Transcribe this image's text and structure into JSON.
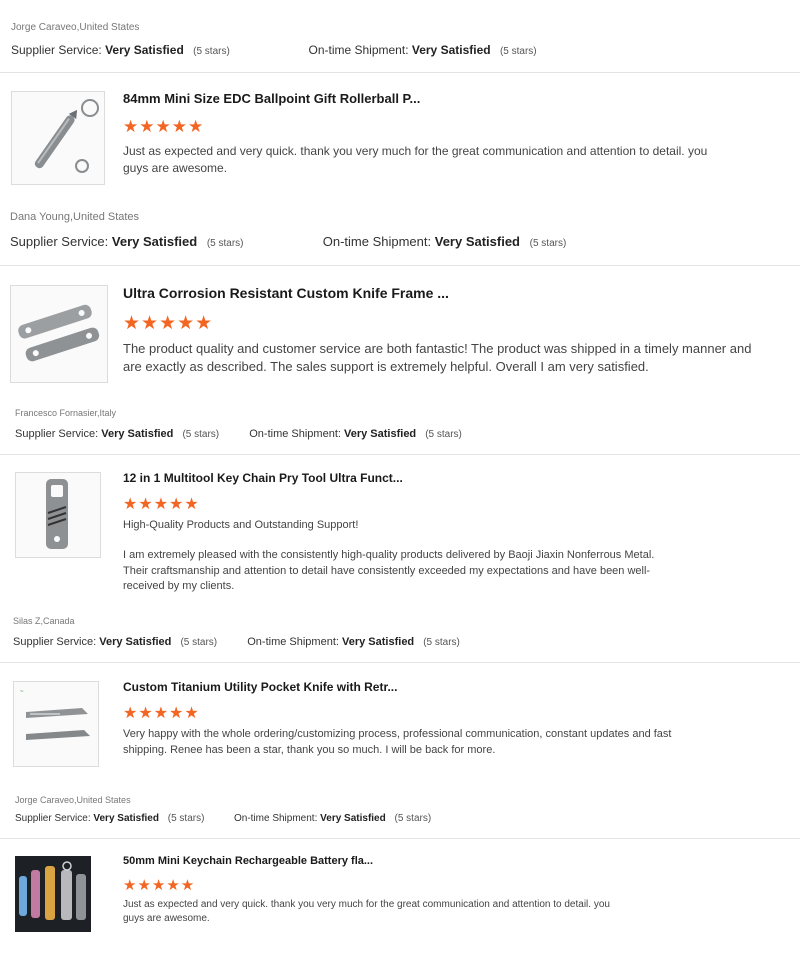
{
  "reviews": [
    {
      "reviewer": "Jorge Caraveo,United States",
      "supplier_label": "Supplier Service:",
      "supplier_value": "Very Satisfied",
      "supplier_stars": "(5 stars)",
      "shipment_label": "On-time Shipment:",
      "shipment_value": "Very Satisfied",
      "shipment_stars": "(5 stars)",
      "product_title": "84mm Mini Size EDC Ballpoint Gift Rollerball P...",
      "rating": 5,
      "stars_text": "★★★★★",
      "text": "Just as expected and very quick. thank you very much for the great communication and attention to detail. you guys are awesome.",
      "thumb_icon": "pen-product-icon"
    },
    {
      "reviewer": "Dana Young,United States",
      "supplier_label": "Supplier Service:",
      "supplier_value": "Very Satisfied",
      "supplier_stars": "(5 stars)",
      "shipment_label": "On-time Shipment:",
      "shipment_value": "Very Satisfied",
      "shipment_stars": "(5 stars)",
      "product_title": "Ultra Corrosion Resistant Custom Knife Frame ...",
      "rating": 5,
      "stars_text": "★★★★★",
      "text": "The product quality and customer service are both fantastic!  The product was shipped in a timely manner and are exactly as described.  The sales support is extremely helpful.  Overall I am very satisfied.",
      "thumb_icon": "knife-frame-product-icon"
    },
    {
      "reviewer": "Francesco Fornasier,Italy",
      "supplier_label": "Supplier Service:",
      "supplier_value": "Very Satisfied",
      "supplier_stars": "(5 stars)",
      "shipment_label": "On-time Shipment:",
      "shipment_value": "Very Satisfied",
      "shipment_stars": "(5 stars)",
      "product_title": "12 in 1 Multitool Key Chain Pry Tool Ultra Funct...",
      "rating": 5,
      "stars_text": "★★★★★",
      "text_heading": "High-Quality Products and Outstanding Support!",
      "text": "I am extremely pleased with the consistently high-quality products delivered by Baoji Jiaxin Nonferrous Metal. Their craftsmanship and attention to detail have consistently exceeded my expectations and have been well-received by my clients.",
      "thumb_icon": "multitool-product-icon"
    },
    {
      "reviewer": "Silas Z,Canada",
      "supplier_label": "Supplier Service:",
      "supplier_value": "Very Satisfied",
      "supplier_stars": "(5 stars)",
      "shipment_label": "On-time Shipment:",
      "shipment_value": "Very Satisfied",
      "shipment_stars": "(5 stars)",
      "product_title": "Custom Titanium Utility Pocket Knife with Retr...",
      "rating": 5,
      "stars_text": "★★★★★",
      "text": "Very happy with the whole ordering/customizing process, professional communication, constant updates and fast shipping. Renee has been a star, thank you so much. I will be back for more.",
      "thumb_icon": "utility-knife-product-icon"
    },
    {
      "reviewer": "Jorge Caraveo,United States",
      "supplier_label": "Supplier Service:",
      "supplier_value": "Very Satisfied",
      "supplier_stars": "(5 stars)",
      "shipment_label": "On-time Shipment:",
      "shipment_value": "Very Satisfied",
      "shipment_stars": "(5 stars)",
      "product_title": "50mm Mini Keychain Rechargeable Battery fla...",
      "rating": 5,
      "stars_text": "★★★★★",
      "text": "Just as expected and very quick. thank you very much for the great communication and attention to detail. you guys are awesome.",
      "thumb_icon": "flashlight-product-icon"
    }
  ],
  "colors": {
    "star": "#f26522",
    "divider": "#e3e3e3"
  }
}
